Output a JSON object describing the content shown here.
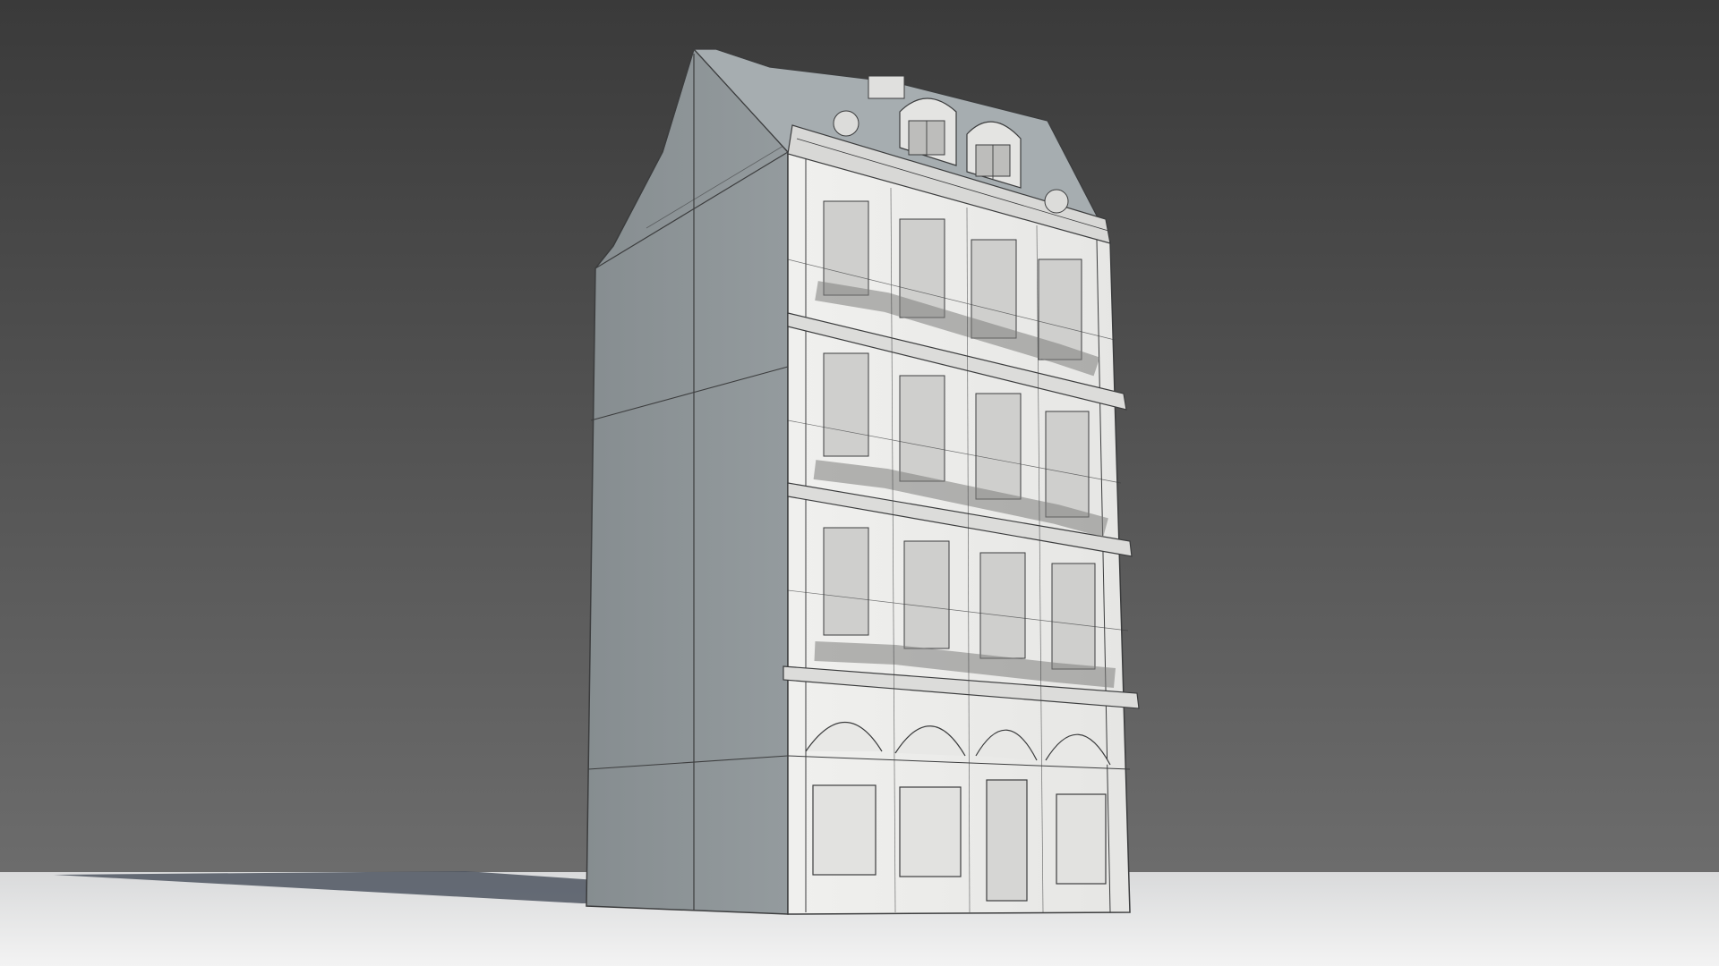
{
  "scene": {
    "subject": "building-model",
    "style": "wireframe-over-clay-render",
    "colors": {
      "sky_top": "#3a3a3a",
      "sky_bottom": "#6c6c6c",
      "ground_near": "#f3f3f3",
      "ground_far": "#d9dadb",
      "shadow": "#4e5560",
      "side_wall": "#8c9396",
      "side_wall_dark": "#7d8487",
      "roof": "#a6adb0",
      "facade": "#eeeeec",
      "facade_shade": "#cfcfcd",
      "detail": "#9a9b99",
      "wire": "#3c3d3e"
    },
    "floors_with_balconies": 3,
    "dormers": 2,
    "arched_bays": 4
  }
}
